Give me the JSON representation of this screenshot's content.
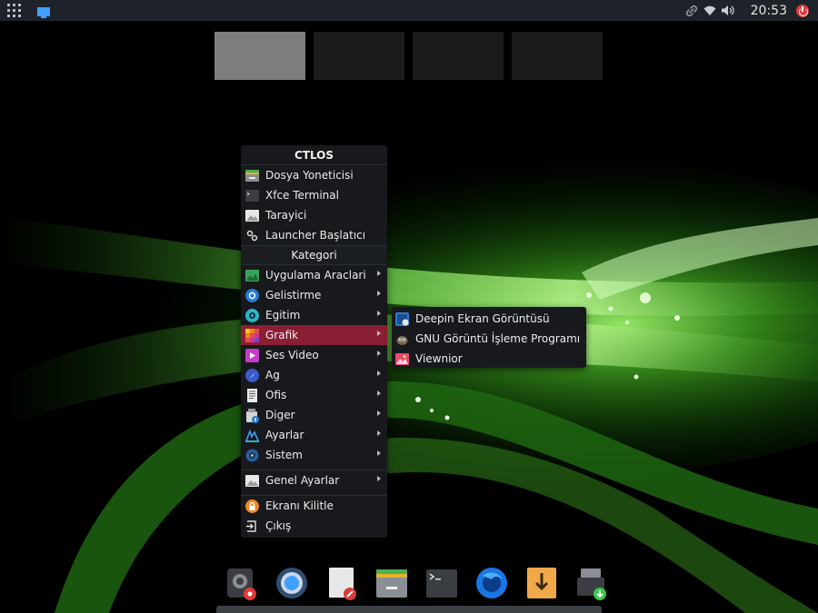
{
  "panel": {
    "clock": "20:53",
    "tray_icons": [
      "link-icon",
      "wifi-icon",
      "volume-icon"
    ],
    "power_icon": "power-icon"
  },
  "workspaces": [
    "1",
    "2",
    "3",
    "4"
  ],
  "menu": {
    "title": "CTLOS",
    "favorites": [
      {
        "label": "Dosya Yoneticisi",
        "icon": "file-manager-icon"
      },
      {
        "label": "Xfce Terminal",
        "icon": "terminal-icon"
      },
      {
        "label": "Tarayici",
        "icon": "browser-icon"
      },
      {
        "label": "Launcher Başlatıcı",
        "icon": "launcher-icon"
      }
    ],
    "category_header": "Kategori",
    "categories": [
      {
        "label": "Uygulama Araclari",
        "icon": "accessories-icon"
      },
      {
        "label": "Gelistirme",
        "icon": "development-icon"
      },
      {
        "label": "Egitim",
        "icon": "education-icon"
      },
      {
        "label": "Grafik",
        "icon": "graphics-icon",
        "selected": true
      },
      {
        "label": "Ses Video",
        "icon": "multimedia-icon"
      },
      {
        "label": "Ag",
        "icon": "network-icon"
      },
      {
        "label": "Ofis",
        "icon": "office-icon"
      },
      {
        "label": "Diger",
        "icon": "other-icon"
      },
      {
        "label": "Ayarlar",
        "icon": "settings-icon"
      },
      {
        "label": "Sistem",
        "icon": "system-icon"
      }
    ],
    "general_settings": {
      "label": "Genel Ayarlar",
      "icon": "general-settings-icon"
    },
    "lock": {
      "label": "Ekranı Kilitle",
      "icon": "lock-icon"
    },
    "logout": {
      "label": "Çıkış",
      "icon": "logout-icon"
    }
  },
  "submenu": {
    "items": [
      {
        "label": "Deepin Ekran Görüntüsü",
        "icon": "screenshot-icon"
      },
      {
        "label": "GNU Görüntü İşleme Programı",
        "icon": "gimp-icon"
      },
      {
        "label": "Viewnior",
        "icon": "image-viewer-icon"
      }
    ]
  },
  "dock": [
    {
      "name": "screenshot-tool-icon"
    },
    {
      "name": "chromium-icon"
    },
    {
      "name": "text-editor-icon"
    },
    {
      "name": "file-manager-icon"
    },
    {
      "name": "terminal-icon"
    },
    {
      "name": "firefox-icon"
    },
    {
      "name": "download-icon"
    },
    {
      "name": "installer-icon"
    }
  ],
  "colors": {
    "accent": "#8a1f34",
    "panel": "#1e2329",
    "menu_bg": "#17191c",
    "wallpaper_glow": "#7ad93a"
  }
}
